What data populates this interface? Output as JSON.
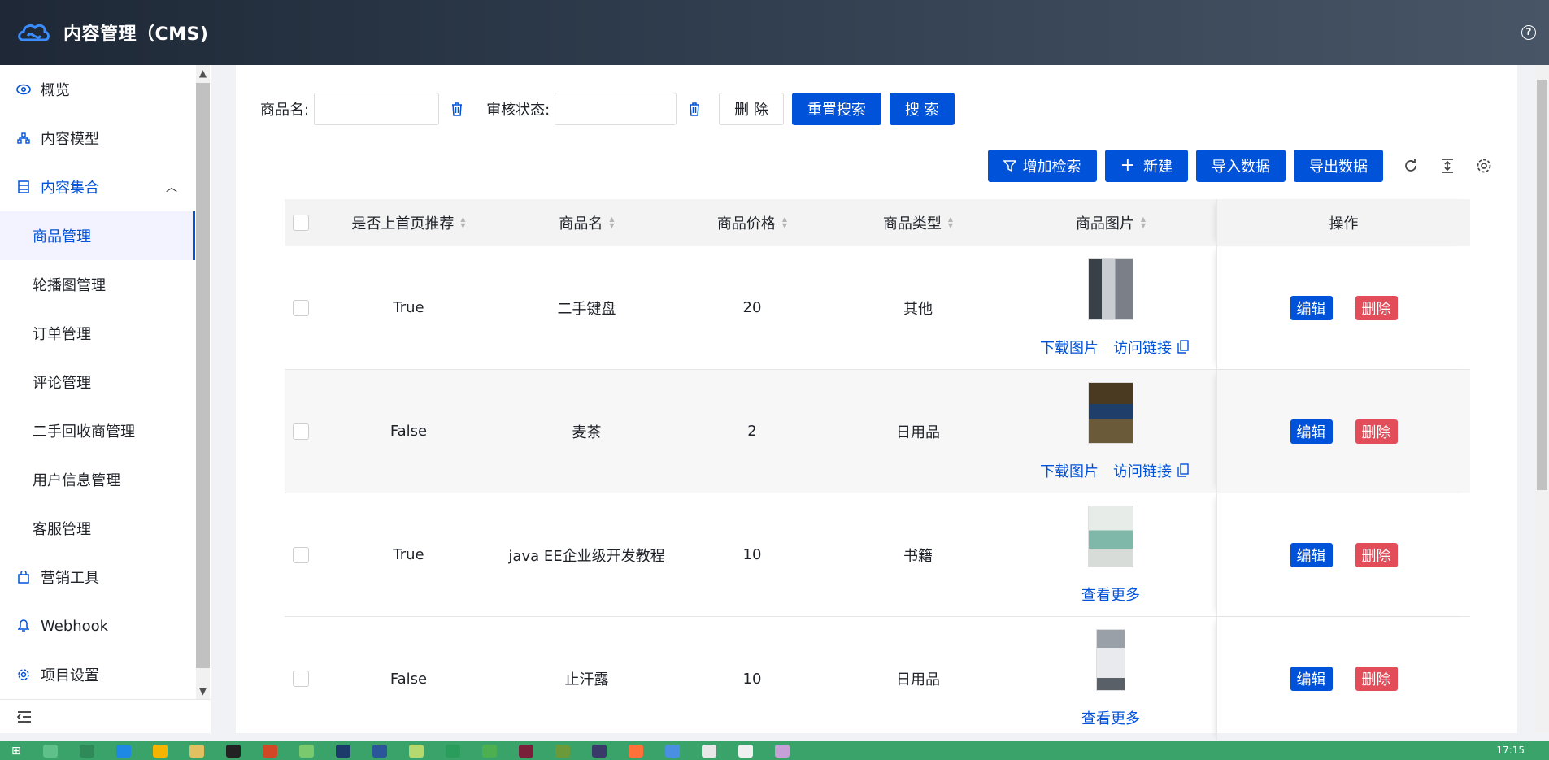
{
  "header": {
    "title": "内容管理（CMS)",
    "help_icon": "help-circle-icon"
  },
  "sidebar": {
    "items": [
      {
        "label": "概览",
        "icon": "eye-icon"
      },
      {
        "label": "内容模型",
        "icon": "model-icon"
      },
      {
        "label": "内容集合",
        "icon": "collection-icon",
        "expanded": true
      }
    ],
    "sub_items": [
      {
        "label": "商品管理",
        "active": true
      },
      {
        "label": "轮播图管理"
      },
      {
        "label": "订单管理"
      },
      {
        "label": "评论管理"
      },
      {
        "label": "二手回收商管理"
      },
      {
        "label": "用户信息管理"
      },
      {
        "label": "客服管理"
      }
    ],
    "bottom_items": [
      {
        "label": "营销工具",
        "icon": "bag-icon"
      },
      {
        "label": "Webhook",
        "icon": "webhook-icon"
      },
      {
        "label": "项目设置",
        "icon": "gear-icon"
      }
    ]
  },
  "search": {
    "name_label": "商品名:",
    "name_value": "",
    "status_label": "审核状态:",
    "status_value": "",
    "delete_label": "删 除",
    "reset_label": "重置搜索",
    "search_label": "搜 索"
  },
  "toolbar": {
    "add_filter_label": "增加检索",
    "new_label": "新建",
    "import_label": "导入数据",
    "export_label": "导出数据"
  },
  "table": {
    "headers": [
      "是否上首页推荐",
      "商品名",
      "商品价格",
      "商品类型",
      "商品图片",
      "操作"
    ],
    "rows": [
      {
        "recommend": "True",
        "name": "二手键盘",
        "price": "20",
        "type": "其他",
        "image_links": true
      },
      {
        "recommend": "False",
        "name": "麦茶",
        "price": "2",
        "type": "日用品",
        "image_links": true
      },
      {
        "recommend": "True",
        "name": "java EE企业级开发教程",
        "price": "10",
        "type": "书籍",
        "image_links": false
      },
      {
        "recommend": "False",
        "name": "止汗露",
        "price": "10",
        "type": "日用品",
        "image_links": false
      }
    ],
    "download_label": "下载图片",
    "visit_label": "访问链接",
    "more_label": "查看更多",
    "edit_label": "编辑",
    "delete_label": "删除"
  },
  "taskbar": {
    "time": "17:15"
  },
  "colors": {
    "primary": "#0052d9",
    "danger": "#e34d59",
    "header_dark": "#1e2836",
    "taskbar": "#3aa36a"
  }
}
